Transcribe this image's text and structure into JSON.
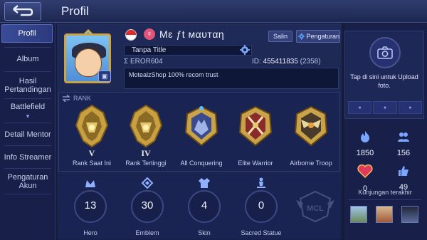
{
  "header": {
    "title": "Profil",
    "back_icon": "back-arrow-icon"
  },
  "sidebar": {
    "items": [
      {
        "label": "Profil",
        "active": true
      },
      {
        "label": "Album"
      },
      {
        "label": "Hasil Pertandingan"
      },
      {
        "label": "Battlefield",
        "chevron": "▾"
      },
      {
        "label": "Detail Mentor"
      },
      {
        "label": "Info Streamer"
      },
      {
        "label": "Pengaturan Akun"
      }
    ]
  },
  "profile": {
    "name": "Mɛ ƒt мαυтαη",
    "gender_symbol": "♀",
    "copy_label": "Salin",
    "settings_label": "Pengaturan",
    "title": "Tanpa Title",
    "server": "Σ EROR604",
    "id_label": "ID: ",
    "id_value": "455411835",
    "id_extra": " (2358)",
    "signature": "MotealzShop 100% recom trust"
  },
  "rank": {
    "header": "RANK",
    "items": [
      {
        "roman": "V",
        "label": "Rank Saat Ini"
      },
      {
        "roman": "IV",
        "label": "Rank Tertinggi"
      },
      {
        "roman": "",
        "label": "All Conquering"
      },
      {
        "roman": "",
        "label": "Elite Warrior"
      },
      {
        "roman": "",
        "label": "Airborne Troop"
      }
    ]
  },
  "stats": [
    {
      "value": "13",
      "label": "Hero",
      "icon": "hero-icon"
    },
    {
      "value": "30",
      "label": "Emblem",
      "icon": "emblem-icon"
    },
    {
      "value": "4",
      "label": "Skin",
      "icon": "skin-icon"
    },
    {
      "value": "0",
      "label": "Sacred Statue",
      "icon": "statue-icon"
    }
  ],
  "right_panel": {
    "upload_text": "Tap di sini untuk Upload foto.",
    "popularity": "1850",
    "followers": "156",
    "charm": "0",
    "likes": "49",
    "visitors_label": "Kunjungan terakhir"
  },
  "colors": {
    "accent": "#5a6cc0",
    "gold": "#c9a34a",
    "background": "#141c3a"
  }
}
